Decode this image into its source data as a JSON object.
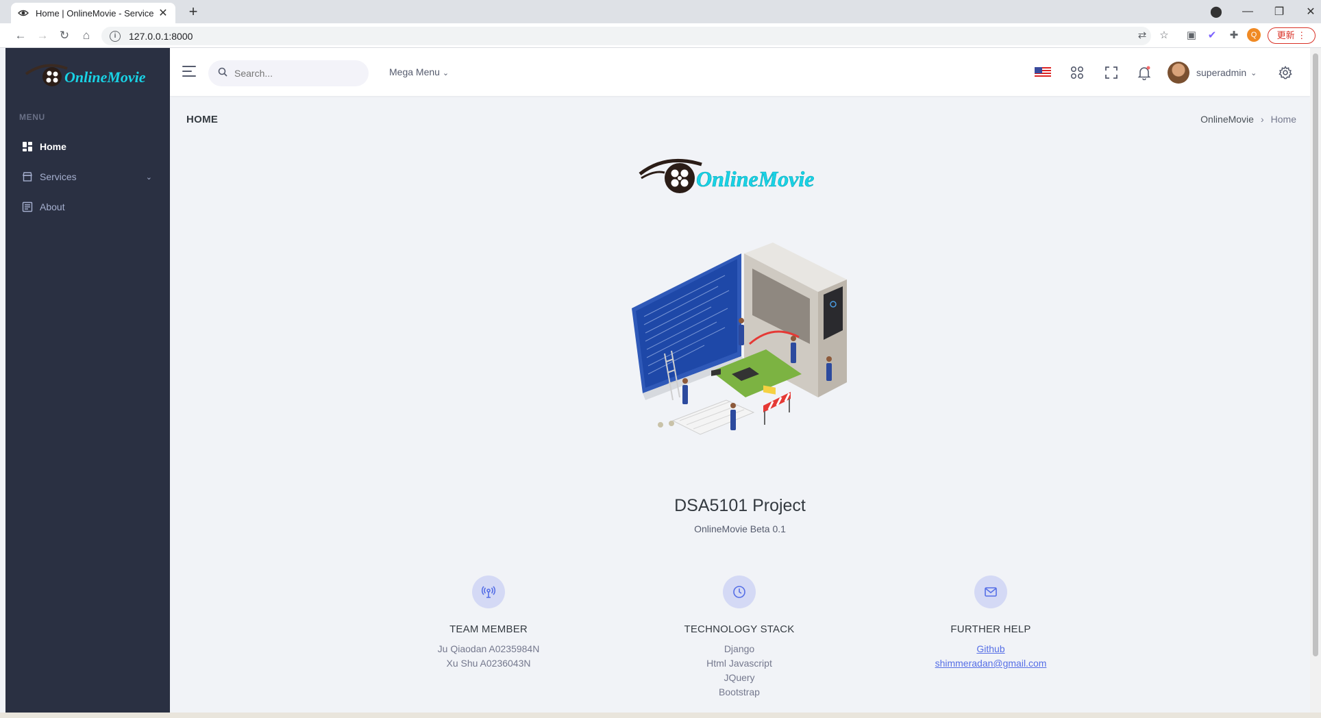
{
  "browser": {
    "tab_title": "Home | OnlineMovie - Service",
    "url": "127.0.0.1:8000",
    "update_label": "更新"
  },
  "sidebar": {
    "brand": "OnlineMovie",
    "menu_title": "MENU",
    "items": [
      {
        "label": "Home",
        "icon": "dashboard-icon",
        "active": true
      },
      {
        "label": "Services",
        "icon": "store-icon",
        "has_submenu": true
      },
      {
        "label": "About",
        "icon": "list-icon"
      }
    ]
  },
  "topbar": {
    "search_placeholder": "Search...",
    "mega_menu_label": "Mega Menu",
    "username": "superadmin"
  },
  "page": {
    "title": "HOME",
    "breadcrumb": [
      "OnlineMovie",
      "Home"
    ],
    "project_title": "DSA5101 Project",
    "project_subtitle": "OnlineMovie Beta 0.1"
  },
  "columns": [
    {
      "icon": "broadcast-icon",
      "title": "TEAM MEMBER",
      "lines": [
        "Ju Qiaodan A0235984N",
        "Xu Shu A0236043N"
      ]
    },
    {
      "icon": "clock-icon",
      "title": "TECHNOLOGY STACK",
      "lines": [
        "Django",
        "Html Javascript",
        "JQuery",
        "Bootstrap"
      ]
    },
    {
      "icon": "mail-icon",
      "title": "FURTHER HELP",
      "links": [
        "Github",
        "shimmeradan@gmail.com"
      ]
    }
  ],
  "colors": {
    "sidebar": "#2a3042",
    "accent": "#556ee6",
    "logo_cyan": "#19d3e6"
  }
}
